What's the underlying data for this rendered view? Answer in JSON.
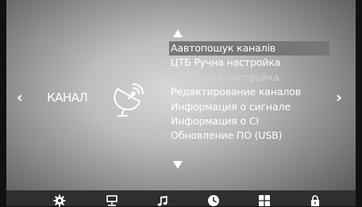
{
  "screen": {
    "section_label": "КАНАЛ"
  },
  "menu": {
    "items": [
      {
        "label": "Аавтопошук каналів",
        "state": "selected"
      },
      {
        "label": "ЦТБ Ручна настройка",
        "state": "normal"
      },
      {
        "label": "АТБ Ручна настройка",
        "state": "disabled"
      },
      {
        "label": "Редактирование каналов",
        "state": "normal"
      },
      {
        "label": "Информация о сигнале",
        "state": "normal"
      },
      {
        "label": "Информация о CI",
        "state": "normal"
      },
      {
        "label": "Обновление ПО (USB)",
        "state": "normal"
      }
    ]
  },
  "icons": {
    "left": "chevron-left-icon",
    "right": "chevron-right-icon",
    "section": "satellite-dish-icon",
    "tabs": [
      "gear-icon",
      "network-icon",
      "music-note-icon",
      "clock-icon",
      "grid-icon",
      "lock-icon"
    ]
  },
  "colors": {
    "selected_bg": "#777777",
    "bottom_bar": "#2f2f2f",
    "text": "#ffffff"
  }
}
